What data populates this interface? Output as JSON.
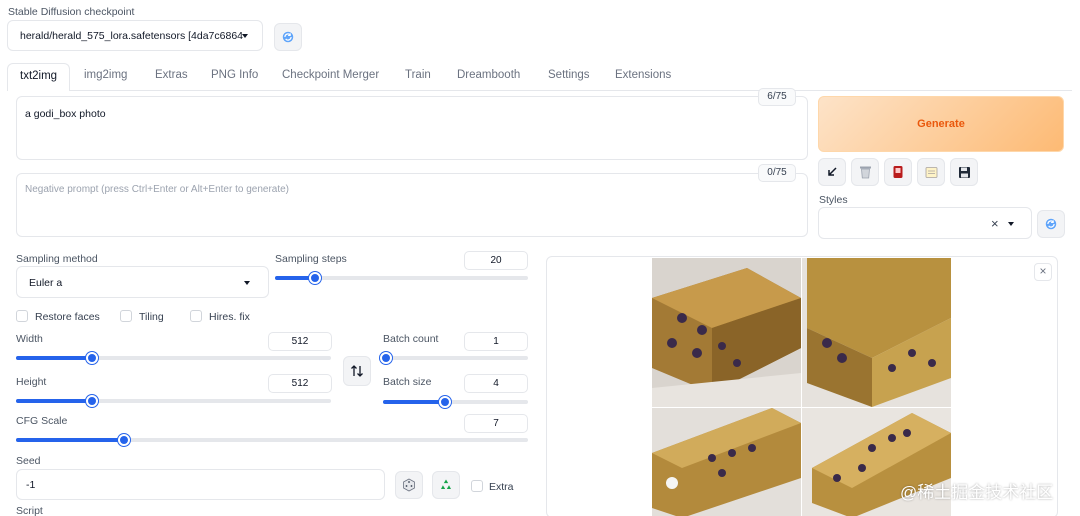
{
  "checkpoint": {
    "label": "Stable Diffusion checkpoint",
    "value": "herald/herald_575_lora.safetensors [4da7c6864"
  },
  "tabs": [
    "txt2img",
    "img2img",
    "Extras",
    "PNG Info",
    "Checkpoint Merger",
    "Train",
    "Dreambooth",
    "Settings",
    "Extensions"
  ],
  "prompt": {
    "value": "a godi_box photo",
    "counter": "6/75"
  },
  "negative_prompt": {
    "placeholder": "Negative prompt (press Ctrl+Enter or Alt+Enter to generate)",
    "counter": "0/75"
  },
  "generate": {
    "label": "Generate"
  },
  "styles": {
    "label": "Styles",
    "clear_glyph": "×"
  },
  "sampling_method": {
    "label": "Sampling method",
    "value": "Euler a"
  },
  "sampling_steps": {
    "label": "Sampling steps",
    "value": "20",
    "fraction": 0.16
  },
  "checkboxes": {
    "restore_faces": "Restore faces",
    "tiling": "Tiling",
    "hires_fix": "Hires. fix",
    "extra": "Extra"
  },
  "width": {
    "label": "Width",
    "value": "512",
    "fraction": 0.24
  },
  "height": {
    "label": "Height",
    "value": "512",
    "fraction": 0.24
  },
  "batch_count": {
    "label": "Batch count",
    "value": "1",
    "fraction": 0.02
  },
  "batch_size": {
    "label": "Batch size",
    "value": "4",
    "fraction": 0.43
  },
  "cfg_scale": {
    "label": "CFG Scale",
    "value": "7",
    "fraction": 0.21
  },
  "seed": {
    "label": "Seed",
    "value": "-1"
  },
  "script": {
    "label": "Script"
  },
  "gallery": {
    "close_glyph": "×"
  },
  "watermark": "@稀土掘金技术社区",
  "colors": {
    "accent": "#2563eb",
    "generate_from": "#fde3c8",
    "generate_to": "#fdba74",
    "generate_text": "#ea580c"
  }
}
